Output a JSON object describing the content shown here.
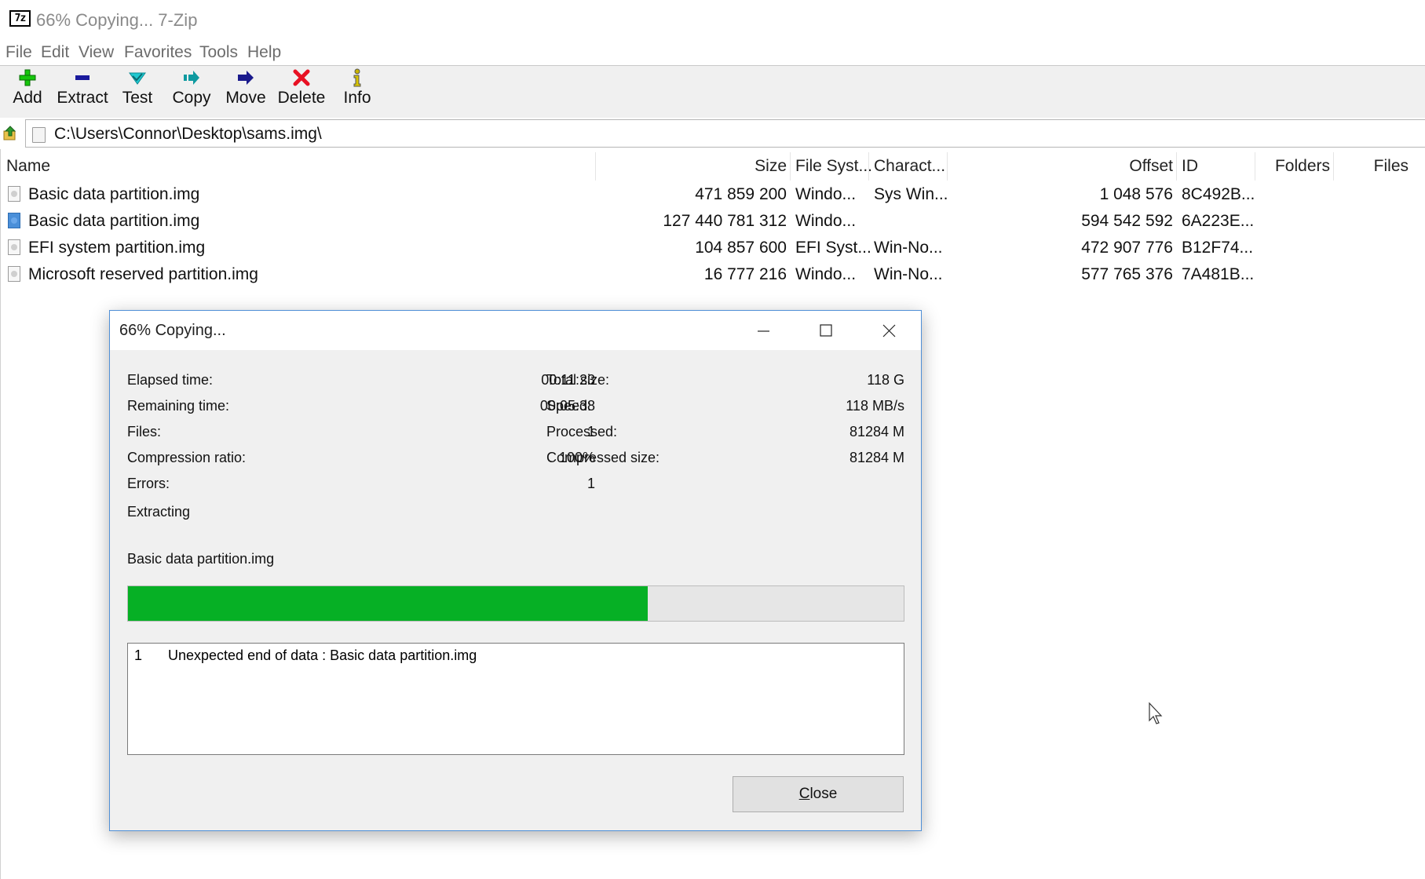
{
  "window": {
    "title": "66% Copying... 7-Zip",
    "logo_text": "7z"
  },
  "menu": [
    "File",
    "Edit",
    "View",
    "Favorites",
    "Tools",
    "Help"
  ],
  "toolbar": {
    "add": "Add",
    "extract": "Extract",
    "test": "Test",
    "copy": "Copy",
    "move": "Move",
    "delete": "Delete",
    "info": "Info"
  },
  "address": {
    "path": "C:\\Users\\Connor\\Desktop\\sams.img\\"
  },
  "columns": {
    "name": "Name",
    "size": "Size",
    "file_system": "File Syst...",
    "characteristics": "Charact...",
    "offset": "Offset",
    "id": "ID",
    "folders": "Folders",
    "files": "Files"
  },
  "rows": [
    {
      "name": "Basic data partition.img",
      "size": "471 859 200",
      "fs": "Windo...",
      "chars": "Sys Win...",
      "offset": "1 048 576",
      "id": "8C492B..."
    },
    {
      "name": "Basic data partition.img",
      "size": "127 440 781 312",
      "fs": "Windo...",
      "chars": "",
      "offset": "594 542 592",
      "id": "6A223E..."
    },
    {
      "name": "EFI system partition.img",
      "size": "104 857 600",
      "fs": "EFI Syst...",
      "chars": "Win-No...",
      "offset": "472 907 776",
      "id": "B12F74..."
    },
    {
      "name": "Microsoft reserved partition.img",
      "size": "16 777 216",
      "fs": "Windo...",
      "chars": "Win-No...",
      "offset": "577 765 376",
      "id": "7A481B..."
    }
  ],
  "dialog": {
    "title": "66% Copying...",
    "elapsed_label": "Elapsed time:",
    "elapsed_value": "00:11:23",
    "remaining_label": "Remaining time:",
    "remaining_value": "00:05:38",
    "files_label": "Files:",
    "files_value": "1",
    "ratio_label": "Compression ratio:",
    "ratio_value": "100%",
    "errors_label": "Errors:",
    "errors_value": "1",
    "total_label": "Total size:",
    "total_value": "118 G",
    "speed_label": "Speed:",
    "speed_value": "118 MB/s",
    "processed_label": "Processed:",
    "processed_value": "81284 M",
    "compressed_label": "Compressed size:",
    "compressed_value": "81284 M",
    "operation": "Extracting",
    "current_file": "Basic data partition.img",
    "progress_fraction": 0.67,
    "log": [
      {
        "num": "1",
        "message": "Unexpected end of data : Basic data partition.img"
      }
    ],
    "close_mnemonic": "C",
    "close_rest": "lose"
  },
  "colors": {
    "progress_fill": "#06b025",
    "dialog_border": "#4f8fd6",
    "delete_icon": "#e81123",
    "add_icon": "#16c60c"
  }
}
